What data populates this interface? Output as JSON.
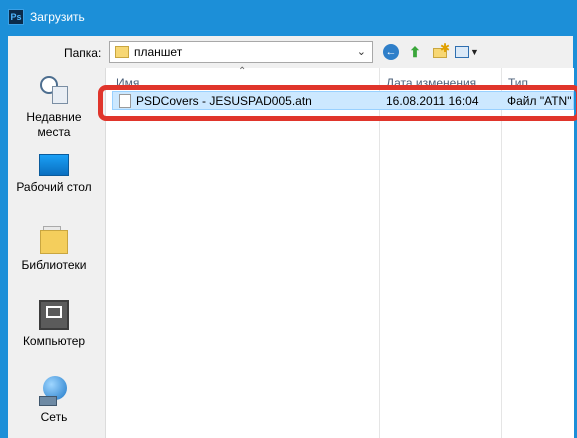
{
  "window": {
    "title": "Загрузить",
    "app_icon": "Ps"
  },
  "toolbar": {
    "folder_label": "Папка:",
    "folder_value": "планшет"
  },
  "places": [
    {
      "label": "Недавние места",
      "icon": "recent-places-icon"
    },
    {
      "label": "Рабочий стол",
      "icon": "desktop-icon"
    },
    {
      "label": "Библиотеки",
      "icon": "libraries-icon"
    },
    {
      "label": "Компьютер",
      "icon": "computer-icon"
    },
    {
      "label": "Сеть",
      "icon": "network-icon"
    }
  ],
  "columns": {
    "name": "Имя",
    "date": "Дата изменения",
    "type": "Тип"
  },
  "files": [
    {
      "name": "PSDCovers - JESUSPAD005.atn",
      "date": "16.08.2011 16:04",
      "type": "Файл \"ATN\""
    }
  ],
  "colors": {
    "titlebar": "#1c8fd8",
    "selection": "#cce8ff",
    "highlight_box": "#e0352b"
  }
}
